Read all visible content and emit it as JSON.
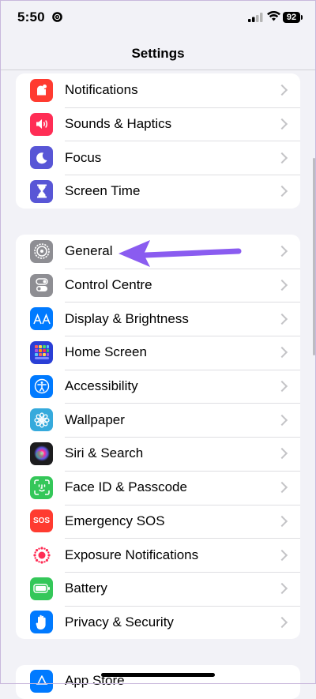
{
  "status": {
    "time": "5:50",
    "battery": "92"
  },
  "nav": {
    "title": "Settings"
  },
  "groups": [
    {
      "items": [
        {
          "label": "Notifications",
          "icon": "bell-icon",
          "color": "#ff3b30"
        },
        {
          "label": "Sounds & Haptics",
          "icon": "speaker-icon",
          "color": "#ff2d55"
        },
        {
          "label": "Focus",
          "icon": "moon-icon",
          "color": "#5856d6"
        },
        {
          "label": "Screen Time",
          "icon": "hourglass-icon",
          "color": "#5856d6"
        }
      ]
    },
    {
      "items": [
        {
          "label": "General",
          "icon": "gear-icon",
          "color": "#8e8e93"
        },
        {
          "label": "Control Centre",
          "icon": "toggles-icon",
          "color": "#8e8e93"
        },
        {
          "label": "Display & Brightness",
          "icon": "aa-icon",
          "color": "#007aff"
        },
        {
          "label": "Home Screen",
          "icon": "grid-icon",
          "color": "#2a3fd6"
        },
        {
          "label": "Accessibility",
          "icon": "accessibility-icon",
          "color": "#007aff"
        },
        {
          "label": "Wallpaper",
          "icon": "flower-icon",
          "color": "#36aadc"
        },
        {
          "label": "Siri & Search",
          "icon": "siri-icon",
          "color": "#1c1c1e"
        },
        {
          "label": "Face ID & Passcode",
          "icon": "faceid-icon",
          "color": "#34c759"
        },
        {
          "label": "Emergency SOS",
          "icon": "sos-icon",
          "color": "#ff3b30",
          "icon_text": "SOS"
        },
        {
          "label": "Exposure Notifications",
          "icon": "exposure-icon",
          "color": "#ffffff"
        },
        {
          "label": "Battery",
          "icon": "battery-icon",
          "color": "#34c759"
        },
        {
          "label": "Privacy & Security",
          "icon": "hand-icon",
          "color": "#007aff"
        }
      ]
    },
    {
      "items": [
        {
          "label": "App Store",
          "icon": "appstore-icon",
          "color": "#007aff"
        }
      ]
    }
  ],
  "annotation": {
    "arrow_color": "#8a5cf0"
  }
}
